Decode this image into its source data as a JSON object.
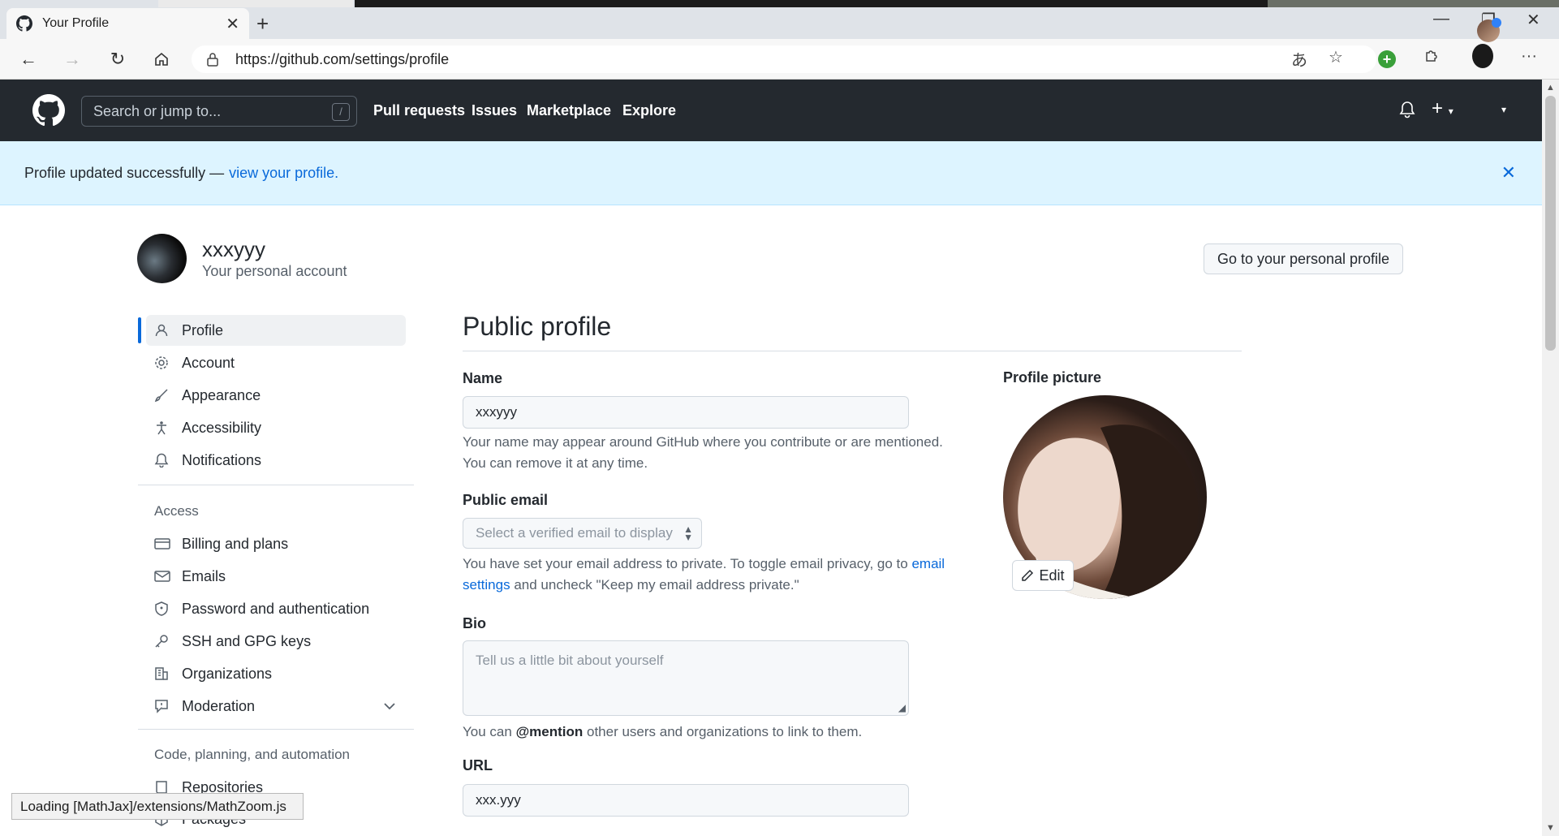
{
  "browser": {
    "tab_title": "Your Profile",
    "url": "https://github.com/settings/profile"
  },
  "github_header": {
    "search_placeholder": "Search or jump to...",
    "search_key": "/",
    "nav": [
      "Pull requests",
      "Issues",
      "Marketplace",
      "Explore"
    ]
  },
  "flash": {
    "message": "Profile updated successfully —",
    "link": "view your profile."
  },
  "account": {
    "username": "xxxyyy",
    "subtitle": "Your personal account",
    "go_profile_button": "Go to your personal profile"
  },
  "sidebar": {
    "items": [
      {
        "label": "Profile",
        "icon": "person-icon"
      },
      {
        "label": "Account",
        "icon": "gear-icon"
      },
      {
        "label": "Appearance",
        "icon": "paintbrush-icon"
      },
      {
        "label": "Accessibility",
        "icon": "accessibility-icon"
      },
      {
        "label": "Notifications",
        "icon": "bell-icon"
      }
    ],
    "access_heading": "Access",
    "access_items": [
      {
        "label": "Billing and plans",
        "icon": "credit-card-icon"
      },
      {
        "label": "Emails",
        "icon": "mail-icon"
      },
      {
        "label": "Password and authentication",
        "icon": "shield-icon"
      },
      {
        "label": "SSH and GPG keys",
        "icon": "key-icon"
      },
      {
        "label": "Organizations",
        "icon": "organization-icon"
      },
      {
        "label": "Moderation",
        "icon": "report-icon"
      }
    ],
    "code_heading": "Code, planning, and automation",
    "code_items": [
      {
        "label": "Repositories",
        "icon": "repo-icon"
      },
      {
        "label": "Packages",
        "icon": "package-icon"
      }
    ]
  },
  "main": {
    "title": "Public profile",
    "name_label": "Name",
    "name_value": "xxxyyy",
    "name_note_1": "Your name may appear around GitHub where you contribute or are mentioned.",
    "name_note_2": "You can remove it at any time.",
    "email_label": "Public email",
    "email_select": "Select a verified email to display",
    "email_note_1": "You have set your email address to private. To toggle email privacy, go to",
    "email_note_link": "email settings",
    "email_note_2": "and uncheck \"Keep my email address private.\"",
    "bio_label": "Bio",
    "bio_placeholder": "Tell us a little bit about yourself",
    "bio_note_1": "You can",
    "bio_note_mention": "@mention",
    "bio_note_2": "other users and organizations to link to them.",
    "url_label": "URL",
    "url_value": "xxx.yyy",
    "picture_label": "Profile picture",
    "edit_button": "Edit"
  },
  "status_popup": "Loading [MathJax]/extensions/MathZoom.js",
  "colors": {
    "header_bg": "#24292f",
    "flash_bg": "#ddf4ff",
    "link": "#0969da",
    "active_bar": "#0969da"
  }
}
